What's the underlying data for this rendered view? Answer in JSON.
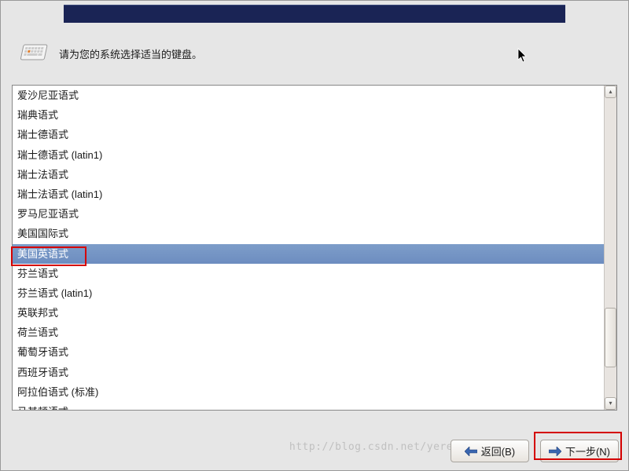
{
  "header": {
    "instruction": "请为您的系统选择适当的键盘。"
  },
  "keyboard_list": {
    "selected_index": 8,
    "highlighted_index": 8,
    "items": [
      "爱沙尼亚语式",
      "瑞典语式",
      "瑞士德语式",
      "瑞士德语式 (latin1)",
      "瑞士法语式",
      "瑞士法语式 (latin1)",
      "罗马尼亚语式",
      "美国国际式",
      "美国英语式",
      "芬兰语式",
      "芬兰语式 (latin1)",
      "英联邦式",
      "荷兰语式",
      "葡萄牙语式",
      "西班牙语式",
      "阿拉伯语式 (标准)",
      "马其顿语式"
    ]
  },
  "scrollbar": {
    "thumb_top_pct": 70,
    "thumb_height_pct": 20
  },
  "buttons": {
    "back_label": "返回(B)",
    "next_label": "下一步(N)"
  },
  "watermark": "http://blog.csdn.net/yerenyuan_pku"
}
